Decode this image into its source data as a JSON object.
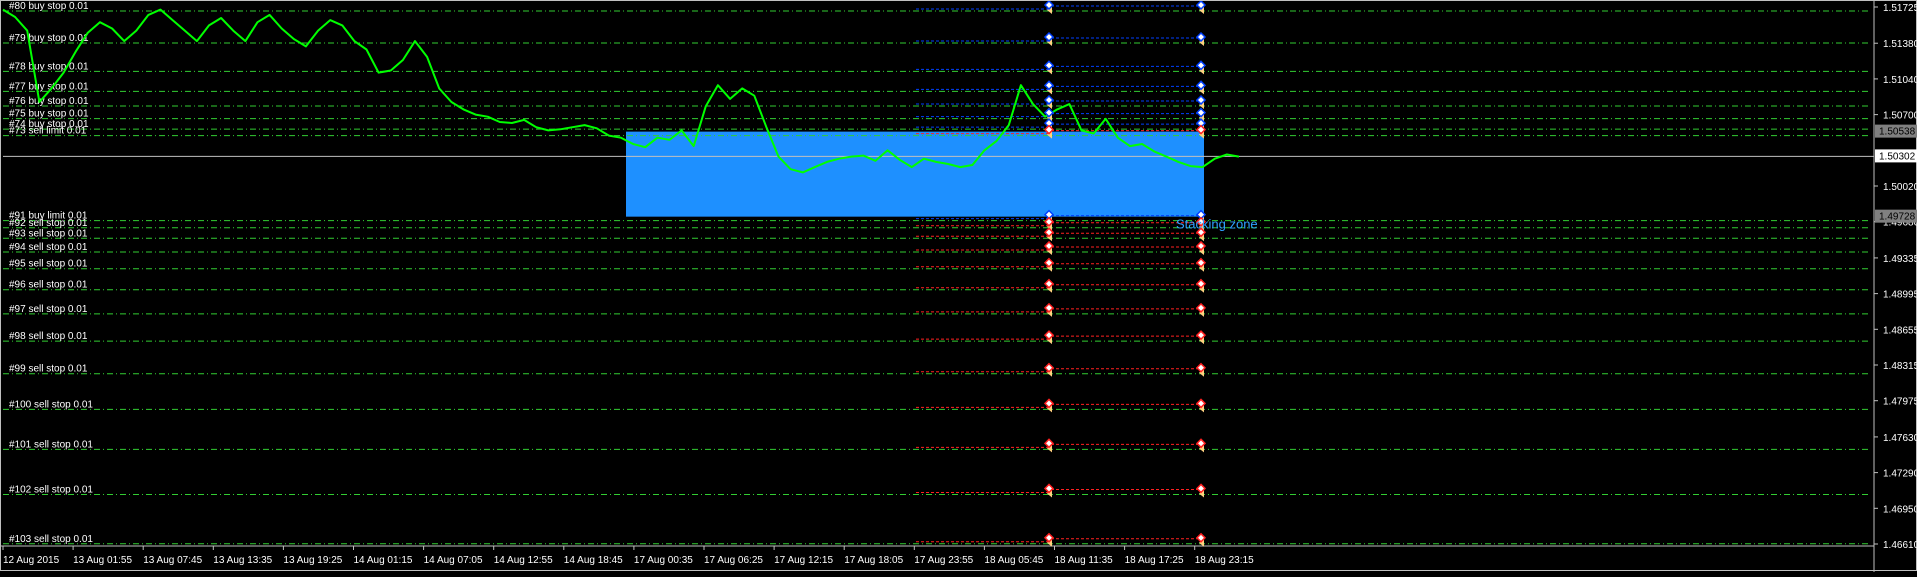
{
  "chart_data": {
    "type": "line",
    "symbol_hint": "forex candlestick chart",
    "x_labels": [
      "12 Aug 2015",
      "13 Aug 01:55",
      "13 Aug 07:45",
      "13 Aug 13:35",
      "13 Aug 19:25",
      "14 Aug 01:15",
      "14 Aug 07:05",
      "14 Aug 12:55",
      "14 Aug 18:45",
      "17 Aug 00:35",
      "17 Aug 06:25",
      "17 Aug 12:15",
      "17 Aug 18:05",
      "17 Aug 23:55",
      "18 Aug 05:45",
      "18 Aug 11:35",
      "18 Aug 17:25",
      "18 Aug 23:15"
    ],
    "y_ticks": [
      "1.51725",
      "1.51380",
      "1.51040",
      "1.50700",
      "1.50020",
      "1.49680",
      "1.49335",
      "1.48995",
      "1.48655",
      "1.48315",
      "1.47975",
      "1.47630",
      "1.47290",
      "1.46950",
      "1.46610"
    ],
    "ylim": [
      1.4661,
      1.51725
    ],
    "price_line": {
      "value": 1.50302,
      "label": "1.50302"
    },
    "zone": {
      "label": "Stacking zone",
      "top": 1.50538,
      "bottom": 1.49728,
      "top_label": "1.50538",
      "bottom_label": "1.49728",
      "color": "#1e90ff"
    },
    "orders": [
      {
        "label": "#80 buy stop 0.01",
        "price": 1.51725,
        "side": "buy"
      },
      {
        "label": "#79 buy stop 0.01",
        "price": 1.5142,
        "side": "buy"
      },
      {
        "label": "#78 buy stop 0.01",
        "price": 1.5115,
        "side": "buy"
      },
      {
        "label": "#77 buy stop 0.01",
        "price": 1.5096,
        "side": "buy"
      },
      {
        "label": "#76 buy stop 0.01",
        "price": 1.5082,
        "side": "buy"
      },
      {
        "label": "#75 buy stop 0.01",
        "price": 1.507,
        "side": "buy"
      },
      {
        "label": "#74 buy stop 0.01",
        "price": 1.506,
        "side": "buy"
      },
      {
        "label": "#73 sell limit 0.01",
        "price": 1.50538,
        "side": "sell"
      },
      {
        "label": "#91 buy limit 0.01",
        "price": 1.49728,
        "side": "buy"
      },
      {
        "label": "#92 sell stop 0.01",
        "price": 1.4966,
        "side": "sell"
      },
      {
        "label": "#93 sell stop 0.01",
        "price": 1.4956,
        "side": "sell"
      },
      {
        "label": "#94 sell stop 0.01",
        "price": 1.4943,
        "side": "sell"
      },
      {
        "label": "#95 sell stop 0.01",
        "price": 1.4927,
        "side": "sell"
      },
      {
        "label": "#96 sell stop 0.01",
        "price": 1.4907,
        "side": "sell"
      },
      {
        "label": "#97 sell stop 0.01",
        "price": 1.4884,
        "side": "sell"
      },
      {
        "label": "#98 sell stop 0.01",
        "price": 1.4858,
        "side": "sell"
      },
      {
        "label": "#99 sell stop 0.01",
        "price": 1.4827,
        "side": "sell"
      },
      {
        "label": "#100 sell stop 0.01",
        "price": 1.4793,
        "side": "sell"
      },
      {
        "label": "#101 sell stop 0.01",
        "price": 1.4755,
        "side": "sell"
      },
      {
        "label": "#102 sell stop 0.01",
        "price": 1.4712,
        "side": "sell"
      },
      {
        "label": "#103 sell stop 0.01",
        "price": 1.4665,
        "side": "sell"
      }
    ],
    "series": [
      {
        "values": [
          1.517,
          1.5163,
          1.515,
          1.5082,
          1.5095,
          1.511,
          1.513,
          1.5148,
          1.5158,
          1.5152,
          1.514,
          1.515,
          1.5165,
          1.517,
          1.516,
          1.515,
          1.514,
          1.5155,
          1.5162,
          1.515,
          1.514,
          1.5158,
          1.5165,
          1.5152,
          1.5142,
          1.5135,
          1.515,
          1.516,
          1.5155,
          1.514,
          1.5132,
          1.511,
          1.5112,
          1.5122,
          1.514,
          1.5125,
          1.5095,
          1.5082,
          1.5075,
          1.507,
          1.5068,
          1.5063,
          1.5062,
          1.5065,
          1.5058,
          1.5055,
          1.5056,
          1.5058,
          1.506,
          1.5057,
          1.505,
          1.5048,
          1.5042,
          1.5039,
          1.5048,
          1.5046,
          1.5055,
          1.504,
          1.5078,
          1.5098,
          1.5085,
          1.5095,
          1.5088,
          1.5058,
          1.503,
          1.5018,
          1.5015,
          1.502,
          1.5025,
          1.5028,
          1.503,
          1.5031,
          1.5026,
          1.5036,
          1.5027,
          1.502,
          1.5028,
          1.5025,
          1.5023,
          1.502,
          1.5022,
          1.5036,
          1.5045,
          1.506,
          1.5098,
          1.508,
          1.5068,
          1.5075,
          1.508,
          1.5055,
          1.5052,
          1.5066,
          1.5048,
          1.504,
          1.5042,
          1.5035,
          1.503,
          1.5025,
          1.5021,
          1.502,
          1.5028,
          1.5032,
          1.503
        ]
      }
    ],
    "markers": {
      "buy_color": "#0040ff",
      "sell_color": "#ff2020",
      "arrow_color": "#ffd080"
    },
    "colors": {
      "background": "#000000",
      "grid_level": "#32cd32",
      "price_line": "#c0c0c0",
      "series": "#00ff00",
      "axis_text": "#ffffff"
    }
  }
}
